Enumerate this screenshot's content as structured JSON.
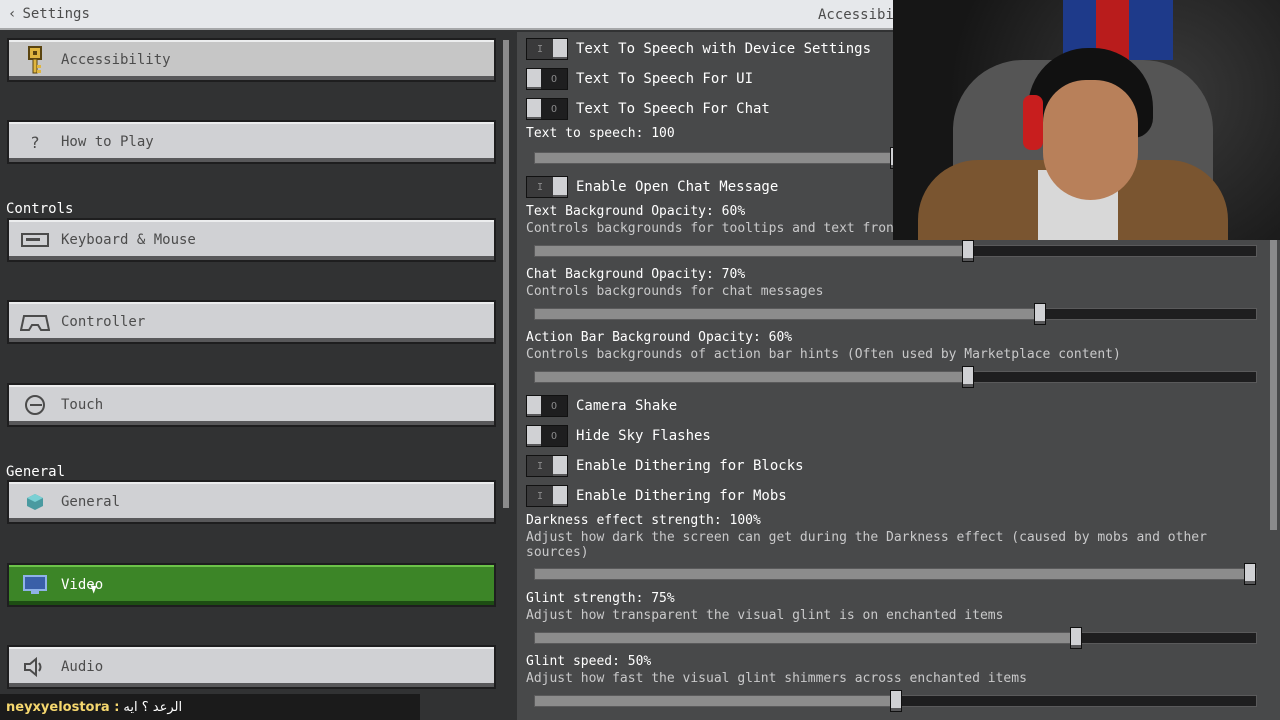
{
  "header": {
    "back_label": "Settings",
    "title": "Accessibili"
  },
  "left": {
    "sections": {
      "controls": "Controls",
      "general": "General"
    },
    "nav": [
      {
        "label": "Accessibility",
        "icon": "key-icon"
      },
      {
        "label": "How to Play",
        "icon": "question-icon"
      },
      {
        "label": "Keyboard & Mouse",
        "icon": "keyboard-icon"
      },
      {
        "label": "Controller",
        "icon": "gamepad-icon"
      },
      {
        "label": "Touch",
        "icon": "touch-icon"
      },
      {
        "label": "General",
        "icon": "cube-icon"
      },
      {
        "label": "Video",
        "icon": "monitor-icon"
      },
      {
        "label": "Audio",
        "icon": "speaker-icon"
      }
    ],
    "selected": "Video",
    "selected_color": "#3c8527"
  },
  "right": {
    "toggles": [
      {
        "label": "Text To Speech with Device Settings",
        "state": "on"
      },
      {
        "label": "Text To Speech For UI",
        "state": "off"
      },
      {
        "label": "Text To Speech For Chat",
        "state": "off"
      },
      {
        "label": "Enable Open Chat Message",
        "state": "on"
      },
      {
        "label": "Camera Shake",
        "state": "off"
      },
      {
        "label": "Hide Sky Flashes",
        "state": "off"
      },
      {
        "label": "Enable Dithering for Blocks",
        "state": "on"
      },
      {
        "label": "Enable Dithering for Mobs",
        "state": "on"
      }
    ],
    "sliders": [
      {
        "label": "Text to speech: 100",
        "desc": "",
        "value": 0.5
      },
      {
        "label": "Text Background Opacity: 60%",
        "desc": "Controls backgrounds for tooltips and text fron",
        "value": 0.6
      },
      {
        "label": "Chat Background Opacity: 70%",
        "desc": "Controls backgrounds for chat messages",
        "value": 0.7
      },
      {
        "label": "Action Bar Background Opacity: 60%",
        "desc": "Controls backgrounds of action bar hints (Often used by Marketplace content)",
        "value": 0.6
      },
      {
        "label": "Darkness effect strength: 100%",
        "desc": "Adjust how dark the screen can get during the Darkness effect (caused by mobs and other sources)",
        "value": 1.0
      },
      {
        "label": "Glint strength: 75%",
        "desc": "Adjust how transparent the visual glint is on enchanted items",
        "value": 0.75
      },
      {
        "label": "Glint speed: 50%",
        "desc": "Adjust how fast the visual glint shimmers across enchanted items",
        "value": 0.5
      }
    ]
  },
  "chat": {
    "user": "neyxyelostora :",
    "message": "الرعد ؟ ايه"
  }
}
